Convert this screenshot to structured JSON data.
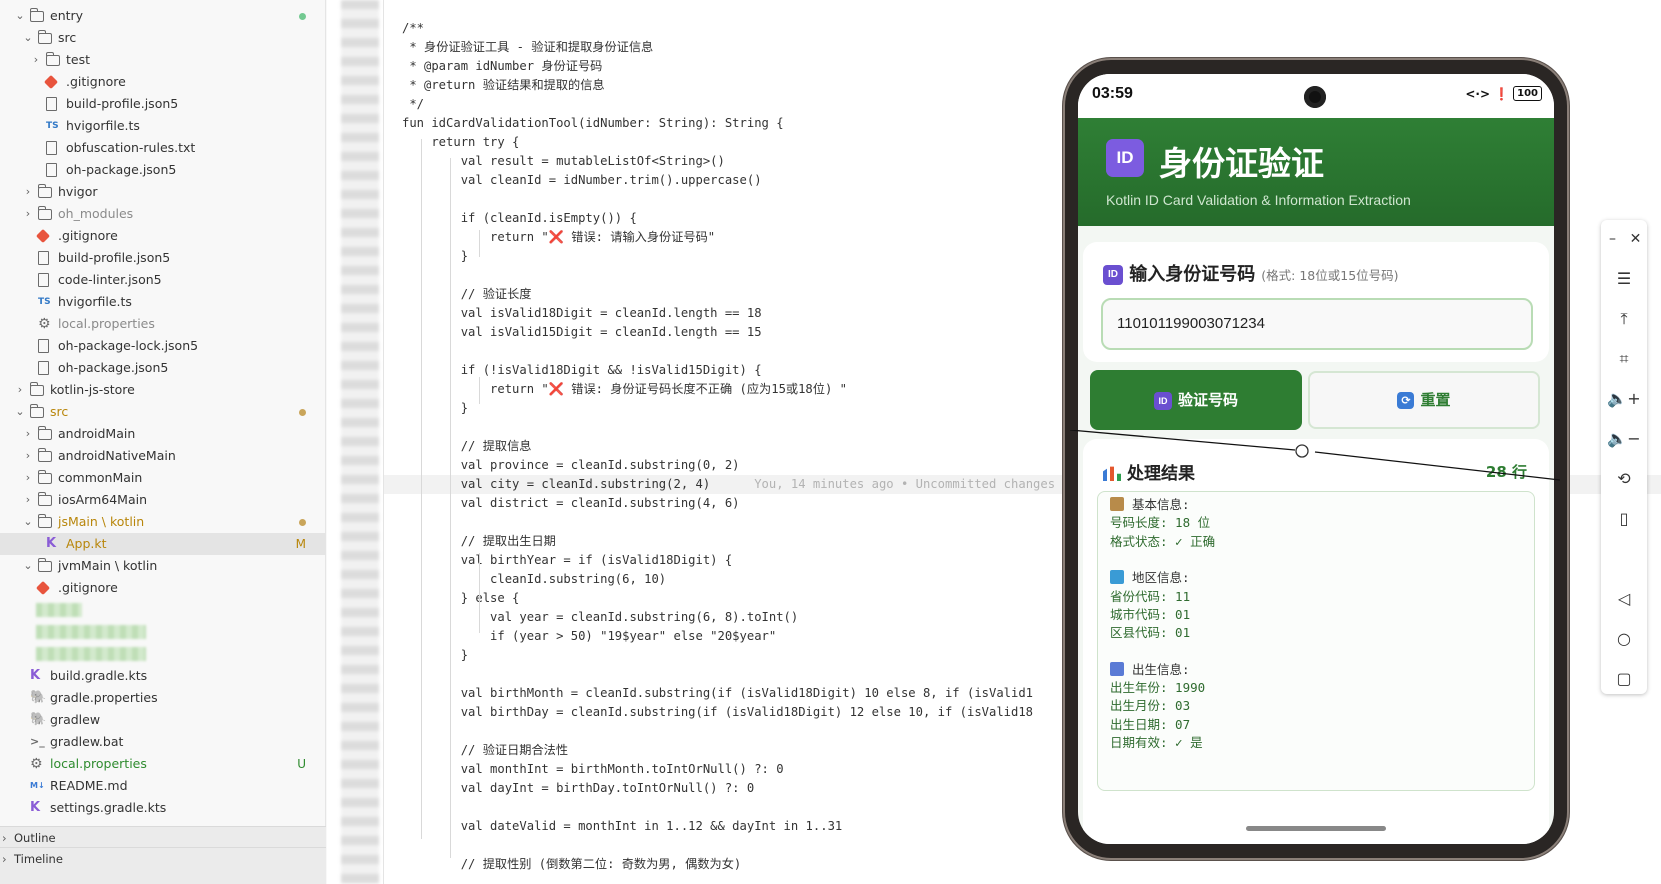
{
  "explorer": {
    "items": [
      {
        "label": "entry",
        "indent": 1,
        "type": "folder",
        "open": true,
        "marker": "green"
      },
      {
        "label": "src",
        "indent": 2,
        "type": "srcfolder",
        "open": true
      },
      {
        "label": "test",
        "indent": 3,
        "type": "srcfolder",
        "open": false
      },
      {
        "label": ".gitignore",
        "indent": 3,
        "type": "git"
      },
      {
        "label": "build-profile.json5",
        "indent": 3,
        "type": "file"
      },
      {
        "label": "hvigorfile.ts",
        "indent": 3,
        "type": "ts"
      },
      {
        "label": "obfuscation-rules.txt",
        "indent": 3,
        "type": "file"
      },
      {
        "label": "oh-package.json5",
        "indent": 3,
        "type": "file"
      },
      {
        "label": "hvigor",
        "indent": 2,
        "type": "folder",
        "open": false
      },
      {
        "label": "oh_modules",
        "indent": 2,
        "type": "folder",
        "open": false,
        "dim": true
      },
      {
        "label": ".gitignore",
        "indent": 2,
        "type": "git"
      },
      {
        "label": "build-profile.json5",
        "indent": 2,
        "type": "file"
      },
      {
        "label": "code-linter.json5",
        "indent": 2,
        "type": "file"
      },
      {
        "label": "hvigorfile.ts",
        "indent": 2,
        "type": "ts"
      },
      {
        "label": "local.properties",
        "indent": 2,
        "type": "gear",
        "dim": true
      },
      {
        "label": "oh-package-lock.json5",
        "indent": 2,
        "type": "file"
      },
      {
        "label": "oh-package.json5",
        "indent": 2,
        "type": "file"
      },
      {
        "label": "kotlin-js-store",
        "indent": 1,
        "type": "folder",
        "open": false
      },
      {
        "label": "src",
        "indent": 1,
        "type": "srcfolder",
        "open": true,
        "marker": "amber",
        "color": "#b8860b"
      },
      {
        "label": "androidMain",
        "indent": 2,
        "type": "folder",
        "open": false
      },
      {
        "label": "androidNativeMain",
        "indent": 2,
        "type": "folder",
        "open": false
      },
      {
        "label": "commonMain",
        "indent": 2,
        "type": "folder",
        "open": false
      },
      {
        "label": "iosArm64Main",
        "indent": 2,
        "type": "folder",
        "open": false
      },
      {
        "label": "jsMain \\ kotlin",
        "indent": 2,
        "type": "folder",
        "open": true,
        "marker": "amber",
        "color": "#b8860b"
      },
      {
        "label": "App.kt",
        "indent": 3,
        "type": "kt",
        "badge": "M",
        "color": "#b8860b",
        "selected": true
      },
      {
        "label": "jvmMain \\ kotlin",
        "indent": 2,
        "type": "folder",
        "open": true
      },
      {
        "label": ".gitignore",
        "indent": 2,
        "type": "git"
      },
      {
        "label": "",
        "indent": 2,
        "type": "blur",
        "w": 46
      },
      {
        "label": "",
        "indent": 2,
        "type": "blur",
        "w": 110
      },
      {
        "label": "",
        "indent": 2,
        "type": "blur",
        "w": 110
      },
      {
        "label": "build.gradle.kts",
        "indent": 1,
        "type": "kt"
      },
      {
        "label": "gradle.properties",
        "indent": 1,
        "type": "gradle"
      },
      {
        "label": "gradlew",
        "indent": 1,
        "type": "gradle"
      },
      {
        "label": "gradlew.bat",
        "indent": 1,
        "type": "term"
      },
      {
        "label": "local.properties",
        "indent": 1,
        "type": "gear",
        "badge": "U",
        "color": "#2e8b2e"
      },
      {
        "label": "README.md",
        "indent": 1,
        "type": "md"
      },
      {
        "label": "settings.gradle.kts",
        "indent": 1,
        "type": "kt"
      }
    ],
    "outline_label": "Outline",
    "timeline_label": "Timeline"
  },
  "editor": {
    "current_line_index": 24,
    "blame": "You, 14 minutes ago • Uncommitted changes",
    "lines": [
      {
        "text": "/**",
        "indent": 0
      },
      {
        "text": " * 身份证验证工具 - 验证和提取身份证信息",
        "indent": 0
      },
      {
        "text": " * @param idNumber 身份证号码",
        "indent": 0
      },
      {
        "text": " * @return 验证结果和提取的信息",
        "indent": 0
      },
      {
        "text": " */",
        "indent": 0
      },
      {
        "text": "fun idCardValidationTool(idNumber: String): String {",
        "indent": 0
      },
      {
        "text": "    return try {",
        "indent": 0
      },
      {
        "text": "        val result = mutableListOf<String>()",
        "indent": 0
      },
      {
        "text": "        val cleanId = idNumber.trim().uppercase()",
        "indent": 0
      },
      {
        "text": "",
        "indent": 0
      },
      {
        "text": "        if (cleanId.isEmpty()) {",
        "indent": 0
      },
      {
        "text": "            return \"❌ 错误: 请输入身份证号码\"",
        "indent": 0
      },
      {
        "text": "        }",
        "indent": 0
      },
      {
        "text": "",
        "indent": 0
      },
      {
        "text": "        // 验证长度",
        "indent": 0
      },
      {
        "text": "        val isValid18Digit = cleanId.length == 18",
        "indent": 0
      },
      {
        "text": "        val isValid15Digit = cleanId.length == 15",
        "indent": 0
      },
      {
        "text": "",
        "indent": 0
      },
      {
        "text": "        if (!isValid18Digit && !isValid15Digit) {",
        "indent": 0
      },
      {
        "text": "            return \"❌ 错误: 身份证号码长度不正确 (应为15或18位) \"",
        "indent": 0
      },
      {
        "text": "        }",
        "indent": 0
      },
      {
        "text": "",
        "indent": 0
      },
      {
        "text": "        // 提取信息",
        "indent": 0
      },
      {
        "text": "        val province = cleanId.substring(0, 2)",
        "indent": 0
      },
      {
        "text": "        val city = cleanId.substring(2, 4)",
        "indent": 0
      },
      {
        "text": "        val district = cleanId.substring(4, 6)",
        "indent": 0
      },
      {
        "text": "",
        "indent": 0
      },
      {
        "text": "        // 提取出生日期",
        "indent": 0
      },
      {
        "text": "        val birthYear = if (isValid18Digit) {",
        "indent": 0
      },
      {
        "text": "            cleanId.substring(6, 10)",
        "indent": 0
      },
      {
        "text": "        } else {",
        "indent": 0
      },
      {
        "text": "            val year = cleanId.substring(6, 8).toInt()",
        "indent": 0
      },
      {
        "text": "            if (year > 50) \"19$year\" else \"20$year\"",
        "indent": 0
      },
      {
        "text": "        }",
        "indent": 0
      },
      {
        "text": "",
        "indent": 0
      },
      {
        "text": "        val birthMonth = cleanId.substring(if (isValid18Digit) 10 else 8, if (isValid1",
        "indent": 0
      },
      {
        "text": "        val birthDay = cleanId.substring(if (isValid18Digit) 12 else 10, if (isValid18",
        "indent": 0
      },
      {
        "text": "",
        "indent": 0
      },
      {
        "text": "        // 验证日期合法性",
        "indent": 0
      },
      {
        "text": "        val monthInt = birthMonth.toIntOrNull() ?: 0",
        "indent": 0
      },
      {
        "text": "        val dayInt = birthDay.toIntOrNull() ?: 0",
        "indent": 0
      },
      {
        "text": "",
        "indent": 0
      },
      {
        "text": "        val dateValid = monthInt in 1..12 && dayInt in 1..31",
        "indent": 0
      },
      {
        "text": "",
        "indent": 0
      },
      {
        "text": "        // 提取性别 (倒数第二位: 奇数为男, 偶数为女)",
        "indent": 0
      }
    ]
  },
  "phone": {
    "time": "03:59",
    "status_icons": "<·> ❗",
    "battery": "100",
    "app_badge": "ID",
    "app_title": "身份证验证",
    "app_subtitle": "Kotlin ID Card Validation & Information Extraction",
    "input_badge": "ID",
    "input_title": "输入身份证号码",
    "input_hint": "(格式: 18位或15位号码)",
    "input_value": "110101199003071234",
    "validate_badge": "ID",
    "validate_label": "验证号码",
    "reset_label": "重置",
    "result_title": "处理结果",
    "line_count": "28 行",
    "result_lines": [
      {
        "text": "基本信息:",
        "head": true,
        "icon": "clipboard",
        "color": "#b88b4a"
      },
      {
        "text": "号码长度: 18 位"
      },
      {
        "text": "格式状态: ✓ 正确"
      },
      {
        "text": ""
      },
      {
        "text": "地区信息:",
        "head": true,
        "icon": "map",
        "color": "#3a9bd5"
      },
      {
        "text": "省份代码: 11"
      },
      {
        "text": "城市代码: 01"
      },
      {
        "text": "区县代码: 01"
      },
      {
        "text": ""
      },
      {
        "text": "出生信息:",
        "head": true,
        "icon": "calendar",
        "color": "#5a7bd5"
      },
      {
        "text": "出生年份: 1990"
      },
      {
        "text": "出生月份: 03"
      },
      {
        "text": "出生日期: 07"
      },
      {
        "text": "日期有效: ✓ 是"
      }
    ]
  },
  "colors": {
    "accent_green": "#2e7d32",
    "modified": "#b8860b",
    "untracked": "#2e8b2e",
    "id_badge": "#7c5ce0"
  }
}
